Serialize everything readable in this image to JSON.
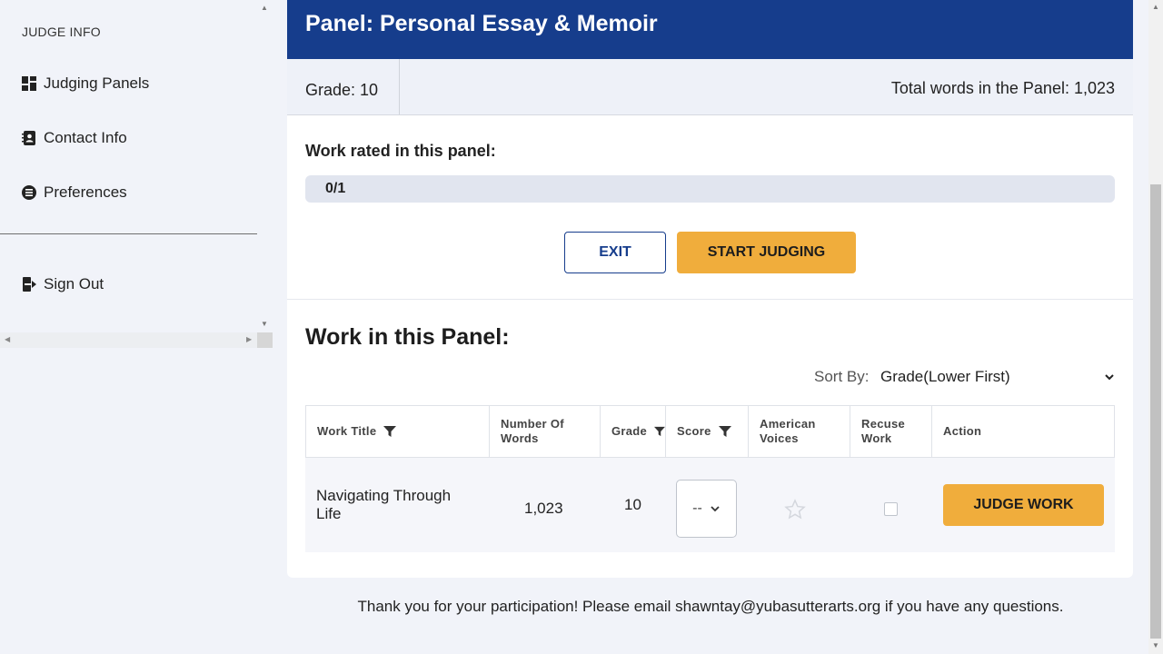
{
  "sidebar": {
    "heading": "JUDGE INFO",
    "items": [
      {
        "label": "Judging Panels",
        "icon": "dashboard-icon"
      },
      {
        "label": "Contact Info",
        "icon": "contact-book-icon"
      },
      {
        "label": "Preferences",
        "icon": "preferences-icon"
      }
    ],
    "sign_out": "Sign Out"
  },
  "panel": {
    "title": "Panel: Personal Essay & Memoir",
    "grade": "Grade: 10",
    "total_words": "Total words in the Panel: 1,023",
    "rated_label": "Work rated in this panel:",
    "progress_text": "0/1",
    "progress_fraction": 0
  },
  "buttons": {
    "exit": "EXIT",
    "start": "START JUDGING"
  },
  "work": {
    "heading": "Work in this Panel:",
    "sort_label": "Sort By:",
    "sort_value": "Grade(Lower First)",
    "columns": [
      "Work Title",
      "Number Of Words",
      "Grade",
      "Score",
      "American Voices",
      "Recuse Work",
      "Action"
    ],
    "rows": [
      {
        "title": "Navigating Through Life",
        "words": "1,023",
        "grade": "10",
        "score": "--",
        "judge_label": "JUDGE WORK"
      }
    ]
  },
  "footer": "Thank you for your participation! Please email shawntay@yubasutterarts.org if you have any questions.",
  "colors": {
    "header_blue": "#163d8c",
    "accent_orange": "#f0ad3c",
    "background": "#f1f3f9"
  }
}
